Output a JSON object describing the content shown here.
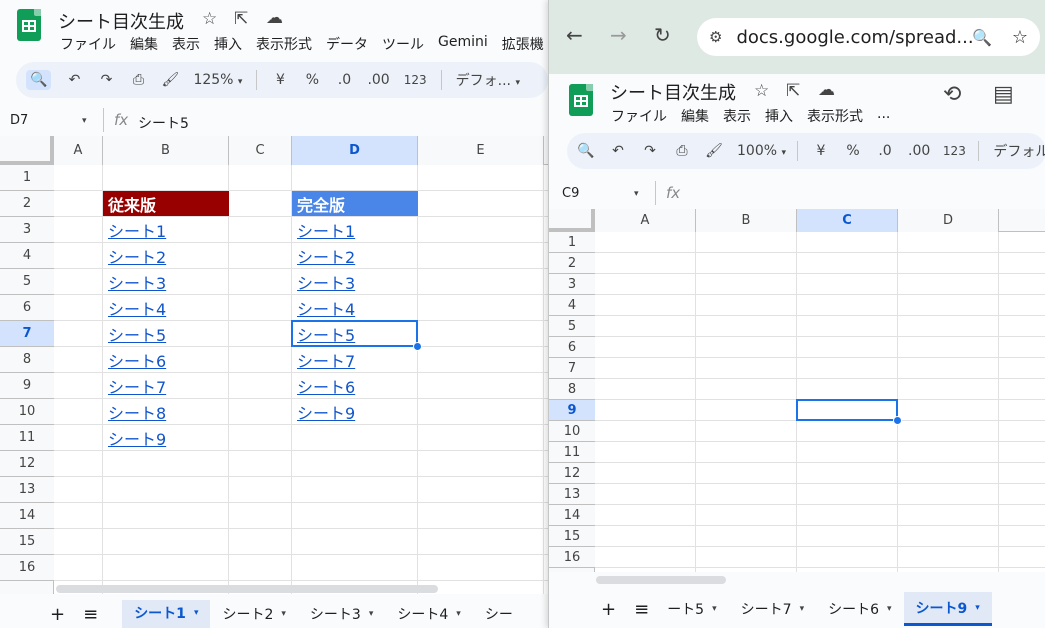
{
  "left": {
    "doc_title": "シート目次生成",
    "menu": [
      "ファイル",
      "編集",
      "表示",
      "挿入",
      "表示形式",
      "データ",
      "ツール",
      "Gemini",
      "拡張機"
    ],
    "toolbar": {
      "zoom": "125%",
      "currency": "¥",
      "percent": "%",
      "dec_down": ".0",
      "dec_up": ".00",
      "number": "123",
      "font": "デフォ..."
    },
    "name_box": "D7",
    "formula": "シート5",
    "columns": [
      "A",
      "B",
      "C",
      "D",
      "E"
    ],
    "selected_column": "D",
    "rows": [
      "1",
      "2",
      "3",
      "4",
      "5",
      "6",
      "7",
      "8",
      "9",
      "10",
      "11",
      "12",
      "13",
      "14",
      "15",
      "16"
    ],
    "selected_row": "7",
    "col_b_header": "従来版",
    "col_b_links": [
      "シート1",
      "シート2",
      "シート3",
      "シート4",
      "シート5",
      "シート6",
      "シート7",
      "シート8",
      "シート9"
    ],
    "col_d_header": "完全版",
    "col_d_links": [
      "シート1",
      "シート2",
      "シート3",
      "シート4",
      "シート5",
      "シート7",
      "シート6",
      "シート9"
    ],
    "tabs": [
      "シート1",
      "シート2",
      "シート3",
      "シート4",
      "シー"
    ],
    "active_tab": "シート1"
  },
  "right": {
    "url": "docs.google.com/spread...",
    "doc_title": "シート目次生成",
    "menu": [
      "ファイル",
      "編集",
      "表示",
      "挿入",
      "表示形式",
      "..."
    ],
    "toolbar": {
      "zoom": "100%",
      "currency": "¥",
      "percent": "%",
      "dec_down": ".0",
      "dec_up": ".00",
      "number": "123",
      "font": "デフォル"
    },
    "name_box": "C9",
    "columns": [
      "A",
      "B",
      "C",
      "D"
    ],
    "selected_column": "C",
    "rows": [
      "1",
      "2",
      "3",
      "4",
      "5",
      "6",
      "7",
      "8",
      "9",
      "10",
      "11",
      "12",
      "13",
      "14",
      "15",
      "16"
    ],
    "selected_row": "9",
    "tabs": [
      "ート5",
      "シート7",
      "シート6",
      "シート9"
    ],
    "active_tab": "シート9"
  },
  "icons": {
    "star": "☆",
    "move": "⇱",
    "cloud": "☁",
    "back": "←",
    "forward": "→",
    "reload": "↻",
    "search": "🔍",
    "undo": "↶",
    "redo": "↷",
    "print": "⎙",
    "paint": "🖌",
    "history": "⟲",
    "comment": "▤",
    "plus": "+",
    "list": "≡",
    "dropdown": "▾",
    "fx": "fx",
    "site_info": "⚙"
  }
}
